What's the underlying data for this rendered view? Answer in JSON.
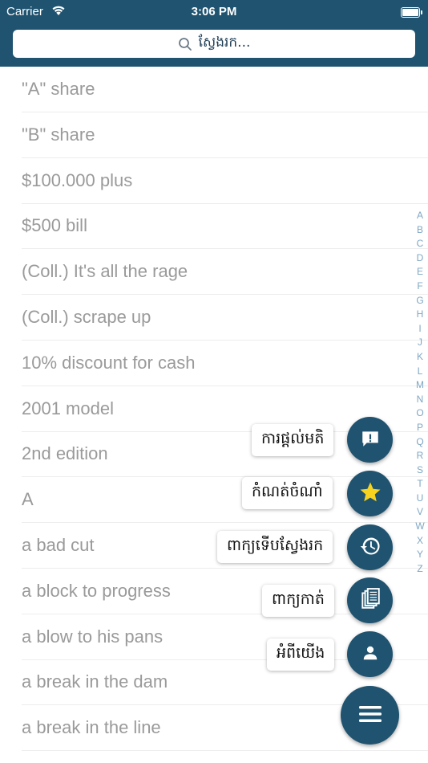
{
  "status": {
    "carrier": "Carrier",
    "time": "3:06 PM"
  },
  "search": {
    "placeholder": "ស្វែងរក..."
  },
  "list": [
    "\"A\" share",
    "\"B\" share",
    "$100.000 plus",
    "$500 bill",
    "(Coll.) It's all the rage",
    "(Coll.) scrape up",
    "10% discount for cash",
    "2001 model",
    "2nd edition",
    "A",
    "a bad cut",
    "a block to progress",
    "a blow to his pans",
    "a break in the dam",
    "a break in the line"
  ],
  "index": [
    "A",
    "B",
    "C",
    "D",
    "E",
    "F",
    "G",
    "H",
    "I",
    "J",
    "K",
    "L",
    "M",
    "N",
    "O",
    "P",
    "Q",
    "R",
    "S",
    "T",
    "U",
    "V",
    "W",
    "X",
    "Y",
    "Z"
  ],
  "menu": {
    "feedback_label": "ការផ្ដល់មតិ",
    "favorites_label": "កំណត់ចំណាំ",
    "history_label": "ពាក្យទើបស្វែងរក",
    "words_label": "ពាក្យកាត់",
    "about_label": "អំពីយើង"
  },
  "colors": {
    "accent": "#1f5370",
    "star": "#f7d21e",
    "list_text": "#9a9a9a",
    "index_text": "#7fa7c4"
  }
}
